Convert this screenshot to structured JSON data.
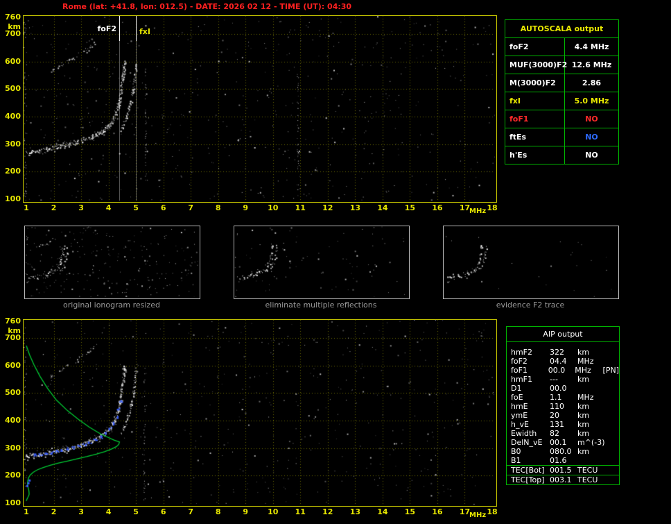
{
  "header": {
    "title": "Rome (lat: +41.8, lon: 012.5) - DATE: 2026 02 12 - TIME (UT): 04:30"
  },
  "colors": {
    "title": "#ff2020",
    "axis": "#e8e800",
    "grid": "#6b6b00",
    "plot_border": "#c8c800",
    "table_green": "#00b400",
    "profile_green": "#00cc33",
    "restored_blue": "#3a5fff",
    "caption_gray": "#9a9a9a"
  },
  "autoscala": {
    "title": "AUTOSCALA output",
    "rows": [
      {
        "label": "foF2",
        "value": "4.4 MHz",
        "color": "#ffffff"
      },
      {
        "label": "MUF(3000)F2",
        "value": "12.6 MHz",
        "color": "#ffffff"
      },
      {
        "label": "M(3000)F2",
        "value": "2.86",
        "color": "#ffffff"
      },
      {
        "label": "fxI",
        "value": "5.0 MHz",
        "color": "#e8e800"
      },
      {
        "label": "foF1",
        "value": "NO",
        "color": "#ff2a2a"
      },
      {
        "label": "ftEs",
        "value": "NO",
        "color": "#ffffff",
        "value_color": "#2e6bff"
      },
      {
        "label": "h'Es",
        "value": "NO",
        "color": "#ffffff"
      }
    ]
  },
  "thumbnails": [
    {
      "caption": "original ionogram resized"
    },
    {
      "caption": "eliminate multiple reflections"
    },
    {
      "caption": "evidence F2 trace"
    }
  ],
  "aip": {
    "title": "AIP output",
    "rows": [
      {
        "label": "hmF2",
        "value": "322",
        "unit": "km"
      },
      {
        "label": "foF2",
        "value": "04.4",
        "unit": "MHz"
      },
      {
        "label": "foF1",
        "value": "00.0",
        "unit": "MHz",
        "extra": "[PN]"
      },
      {
        "label": "hmF1",
        "value": "---",
        "unit": "km"
      },
      {
        "label": "D1",
        "value": "00.0",
        "unit": ""
      },
      {
        "label": "foE",
        "value": "1.1",
        "unit": "MHz"
      },
      {
        "label": "hmE",
        "value": "110",
        "unit": "km"
      },
      {
        "label": "ymE",
        "value": "20",
        "unit": "km"
      },
      {
        "label": "h_vE",
        "value": "131",
        "unit": "km"
      },
      {
        "label": "Ewidth",
        "value": "82",
        "unit": "km"
      },
      {
        "label": "DelN_vE",
        "value": "00.1",
        "unit": "m^(-3)"
      },
      {
        "label": "B0",
        "value": "080.0",
        "unit": "km"
      },
      {
        "label": "B1",
        "value": "01.6",
        "unit": ""
      }
    ],
    "tec_rows": [
      {
        "label": "TEC[Bot]",
        "value": "001.5",
        "unit": "TECU"
      },
      {
        "label": "TEC[Top]",
        "value": "003.1",
        "unit": "TECU"
      }
    ]
  },
  "chart_data": [
    {
      "type": "scatter",
      "title": "ionogram with AUTOSCALA interpretation",
      "xlabel": "MHz",
      "ylabel": "km",
      "xlim": [
        1,
        18
      ],
      "ylim": [
        100,
        760
      ],
      "x_ticks": [
        1,
        2,
        3,
        4,
        5,
        6,
        7,
        8,
        9,
        10,
        11,
        12,
        13,
        14,
        15,
        16,
        17,
        18
      ],
      "y_ticks": [
        760,
        700,
        600,
        500,
        400,
        300,
        200,
        100
      ],
      "grid": true,
      "markers": {
        "foF2_label": "foF2",
        "foF2_MHz": 4.4,
        "fxI_label": "fxI",
        "fxI_MHz": 5.0
      },
      "f2_trace": [
        [
          1.0,
          272
        ],
        [
          1.2,
          275
        ],
        [
          1.4,
          278
        ],
        [
          1.6,
          281
        ],
        [
          1.8,
          284
        ],
        [
          2.0,
          288
        ],
        [
          2.2,
          292
        ],
        [
          2.4,
          296
        ],
        [
          2.6,
          301
        ],
        [
          2.8,
          306
        ],
        [
          3.0,
          312
        ],
        [
          3.2,
          319
        ],
        [
          3.4,
          327
        ],
        [
          3.6,
          337
        ],
        [
          3.8,
          350
        ],
        [
          4.0,
          367
        ],
        [
          4.1,
          380
        ],
        [
          4.2,
          398
        ],
        [
          4.3,
          422
        ],
        [
          4.38,
          452
        ],
        [
          4.44,
          492
        ],
        [
          4.5,
          535
        ],
        [
          4.55,
          572
        ],
        [
          4.6,
          602
        ]
      ],
      "x_mode_trace": [
        [
          4.45,
          352
        ],
        [
          4.55,
          375
        ],
        [
          4.65,
          402
        ],
        [
          4.75,
          432
        ],
        [
          4.85,
          470
        ],
        [
          4.92,
          512
        ],
        [
          4.97,
          555
        ],
        [
          5.0,
          592
        ]
      ],
      "second_hop_trace": [
        [
          1.8,
          556
        ],
        [
          2.1,
          576
        ],
        [
          2.4,
          594
        ],
        [
          2.7,
          612
        ],
        [
          3.0,
          630
        ],
        [
          3.2,
          644
        ],
        [
          3.4,
          660
        ],
        [
          3.55,
          672
        ]
      ],
      "interference_lines_MHz": [
        5.35,
        10.9
      ]
    },
    {
      "type": "scatter",
      "title": "ionogram with restored trace and electron density profile",
      "xlabel": "MHz",
      "ylabel": "km",
      "xlim": [
        1,
        18
      ],
      "ylim": [
        100,
        760
      ],
      "x_ticks": [
        1,
        2,
        3,
        4,
        5,
        6,
        7,
        8,
        9,
        10,
        11,
        12,
        13,
        14,
        15,
        16,
        17,
        18
      ],
      "y_ticks": [
        760,
        700,
        600,
        500,
        400,
        300,
        200,
        100
      ],
      "grid": true,
      "f2_trace": [
        [
          1.0,
          272
        ],
        [
          1.2,
          275
        ],
        [
          1.4,
          278
        ],
        [
          1.6,
          281
        ],
        [
          1.8,
          284
        ],
        [
          2.0,
          288
        ],
        [
          2.2,
          292
        ],
        [
          2.4,
          296
        ],
        [
          2.6,
          301
        ],
        [
          2.8,
          306
        ],
        [
          3.0,
          312
        ],
        [
          3.2,
          319
        ],
        [
          3.4,
          327
        ],
        [
          3.6,
          337
        ],
        [
          3.8,
          350
        ],
        [
          4.0,
          367
        ],
        [
          4.1,
          380
        ],
        [
          4.2,
          398
        ],
        [
          4.3,
          422
        ],
        [
          4.38,
          452
        ],
        [
          4.44,
          492
        ],
        [
          4.5,
          535
        ],
        [
          4.55,
          572
        ],
        [
          4.6,
          602
        ]
      ],
      "x_mode_trace": [
        [
          4.45,
          352
        ],
        [
          4.55,
          375
        ],
        [
          4.65,
          402
        ],
        [
          4.75,
          432
        ],
        [
          4.85,
          470
        ],
        [
          4.92,
          512
        ],
        [
          4.97,
          555
        ],
        [
          5.0,
          592
        ]
      ],
      "second_hop_trace": [
        [
          1.8,
          556
        ],
        [
          2.1,
          576
        ],
        [
          2.4,
          594
        ],
        [
          2.7,
          612
        ],
        [
          3.0,
          630
        ],
        [
          3.2,
          644
        ],
        [
          3.4,
          660
        ],
        [
          3.55,
          672
        ]
      ],
      "interference_lines_MHz": [
        5.3
      ],
      "profile": [
        [
          1.0,
          672
        ],
        [
          1.12,
          638
        ],
        [
          1.28,
          602
        ],
        [
          1.5,
          560
        ],
        [
          1.78,
          516
        ],
        [
          2.1,
          474
        ],
        [
          2.5,
          436
        ],
        [
          2.9,
          404
        ],
        [
          3.3,
          376
        ],
        [
          3.7,
          352
        ],
        [
          4.0,
          338
        ],
        [
          4.2,
          329
        ],
        [
          4.35,
          324
        ],
        [
          4.4,
          322
        ],
        [
          4.37,
          313
        ],
        [
          4.28,
          305
        ],
        [
          4.1,
          296
        ],
        [
          3.85,
          287
        ],
        [
          3.55,
          278
        ],
        [
          3.2,
          269
        ],
        [
          2.85,
          261
        ],
        [
          2.5,
          253
        ],
        [
          2.15,
          245
        ],
        [
          1.85,
          237
        ],
        [
          1.6,
          229
        ],
        [
          1.4,
          221
        ],
        [
          1.25,
          212
        ],
        [
          1.14,
          202
        ],
        [
          1.08,
          192
        ],
        [
          1.05,
          181
        ],
        [
          1.04,
          170
        ],
        [
          1.06,
          158
        ],
        [
          1.09,
          147
        ],
        [
          1.1,
          138
        ],
        [
          1.1,
          131
        ],
        [
          1.06,
          122
        ],
        [
          1.02,
          114
        ],
        [
          1.0,
          108
        ]
      ],
      "restored_trace": [
        [
          1.3,
          277
        ],
        [
          1.5,
          280
        ],
        [
          1.7,
          282
        ],
        [
          1.9,
          285
        ],
        [
          2.1,
          290
        ],
        [
          2.3,
          294
        ],
        [
          2.5,
          298
        ],
        [
          2.7,
          303
        ],
        [
          2.9,
          309
        ],
        [
          3.1,
          316
        ],
        [
          3.3,
          323
        ],
        [
          3.5,
          332
        ],
        [
          3.7,
          342
        ],
        [
          3.9,
          356
        ],
        [
          4.05,
          372
        ],
        [
          4.18,
          392
        ],
        [
          4.28,
          415
        ],
        [
          4.36,
          442
        ],
        [
          4.42,
          470
        ]
      ],
      "blue_marks": [
        [
          1.0,
          166
        ],
        [
          1.04,
          176
        ],
        [
          1.08,
          186
        ]
      ]
    }
  ]
}
